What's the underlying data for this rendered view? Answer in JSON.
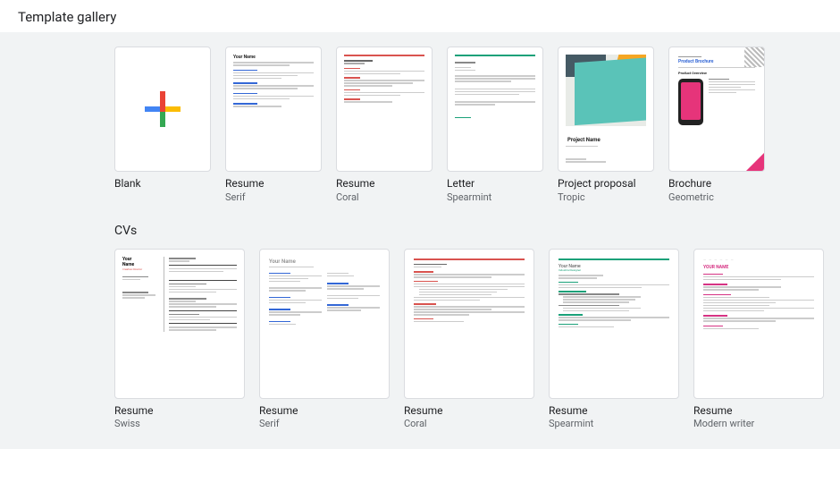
{
  "header": {
    "title": "Template gallery"
  },
  "section_cvs": "CVs",
  "top_templates": [
    {
      "title": "Blank",
      "subtitle": ""
    },
    {
      "title": "Resume",
      "subtitle": "Serif"
    },
    {
      "title": "Resume",
      "subtitle": "Coral"
    },
    {
      "title": "Letter",
      "subtitle": "Spearmint"
    },
    {
      "title": "Project proposal",
      "subtitle": "Tropic"
    },
    {
      "title": "Brochure",
      "subtitle": "Geometric"
    }
  ],
  "cv_templates": [
    {
      "title": "Resume",
      "subtitle": "Swiss"
    },
    {
      "title": "Resume",
      "subtitle": "Serif"
    },
    {
      "title": "Resume",
      "subtitle": "Coral"
    },
    {
      "title": "Resume",
      "subtitle": "Spearmint"
    },
    {
      "title": "Resume",
      "subtitle": "Modern writer"
    }
  ]
}
